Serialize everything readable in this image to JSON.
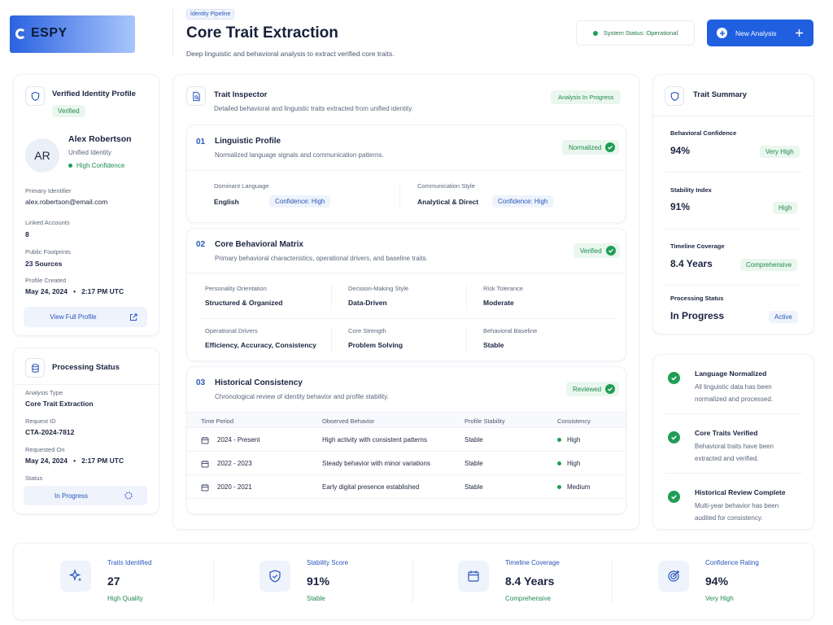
{
  "brand": {
    "name": "ESPY",
    "gradient_from": "#2a62e0",
    "gradient_to": "#a9c6fb"
  },
  "header": {
    "breadcrumb": "Identity Pipeline",
    "title": "Core Trait Extraction",
    "subtitle": "Deep linguistic and behavioral analysis to extract verified core traits.",
    "system_status": "System Status: Operational",
    "new_analysis": "New Analysis"
  },
  "profile": {
    "title": "Verified Identity Profile",
    "verified_badge": "Verified",
    "initials": "AR",
    "name": "Alex Robertson",
    "role": "Unified Identity",
    "confidence": "High Confidence",
    "fields": [
      {
        "label": "Primary Identifier",
        "value": "alex.robertson@email.com"
      },
      {
        "label": "Linked Accounts",
        "value": "8"
      },
      {
        "label": "Public Footprints",
        "value": "23 Sources"
      },
      {
        "label": "Profile Created",
        "value": "May 24, 2024   •   2:17 PM UTC"
      }
    ],
    "view_button": "View Full Profile"
  },
  "processing": {
    "title": "Processing Status",
    "fields": [
      {
        "label": "Analysis Type",
        "value": "Core Trait Extraction"
      },
      {
        "label": "Request ID",
        "value": "CTA-2024-7812"
      },
      {
        "label": "Requested On",
        "value": "May 24, 2024   •   2:17 PM UTC"
      }
    ],
    "status_label": "Status",
    "status_value": "In Progress"
  },
  "inspector": {
    "title": "Trait Inspector",
    "subtitle": "Detailed behavioral and linguistic traits extracted from unified identity.",
    "badge": "Analysis In Progress",
    "linguistic": {
      "num": "01",
      "title": "Linguistic Profile",
      "subtitle": "Normalized language signals and communication patterns.",
      "badge": "Normalized",
      "language_label": "Dominant Language",
      "language_value": "English",
      "language_conf": "Confidence: High",
      "style_label": "Communication Style",
      "style_value": "Analytical & Direct",
      "style_conf": "Confidence: High"
    },
    "behavioral": {
      "num": "02",
      "title": "Core Behavioral Matrix",
      "subtitle": "Primary behavioral characteristics, operational drivers, and baseline traits.",
      "badge": "Verified",
      "cells": [
        {
          "label": "Personality Orientation",
          "value": "Structured & Organized"
        },
        {
          "label": "Decision-Making Style",
          "value": "Data-Driven"
        },
        {
          "label": "Risk Tolerance",
          "value": "Moderate"
        },
        {
          "label": "Operational Drivers",
          "value": "Efficiency, Accuracy, Consistency"
        },
        {
          "label": "Core Strength",
          "value": "Problem Solving"
        },
        {
          "label": "Behavioral Baseline",
          "value": "Stable"
        }
      ]
    },
    "historical": {
      "num": "03",
      "title": "Historical Consistency",
      "subtitle": "Chronological review of identity behavior and profile stability.",
      "badge": "Reviewed",
      "columns": [
        "Time Period",
        "Observed Behavior",
        "Profile Stability",
        "Consistency"
      ],
      "rows": [
        {
          "period": "2024 - Present",
          "behavior": "High activity with consistent patterns",
          "stability": "Stable",
          "consistency": "High"
        },
        {
          "period": "2022 - 2023",
          "behavior": "Steady behavior with minor variations",
          "stability": "Stable",
          "consistency": "High"
        },
        {
          "period": "2020 - 2021",
          "behavior": "Early digital presence established",
          "stability": "Stable",
          "consistency": "Medium"
        }
      ]
    }
  },
  "summary": {
    "title": "Trait Summary",
    "items": [
      {
        "label": "Behavioral Confidence",
        "value": "94%",
        "badge": "Very High"
      },
      {
        "label": "Stability Index",
        "value": "91%",
        "badge": "High"
      },
      {
        "label": "Timeline Coverage",
        "value": "8.4 Years",
        "badge": "Comprehensive"
      },
      {
        "label": "Processing Status",
        "value": "In Progress",
        "badge": "Active"
      }
    ]
  },
  "checklist": [
    {
      "title": "Language Normalized",
      "line1": "All linguistic data has been",
      "line2": "normalized and processed."
    },
    {
      "title": "Core Traits Verified",
      "line1": "Behavioral traits have been",
      "line2": "extracted and verified."
    },
    {
      "title": "Historical Review Complete",
      "line1": "Multi-year behavior has been",
      "line2": "audited for consistency."
    }
  ],
  "stats": [
    {
      "label": "Traits Identified",
      "value": "27",
      "note": "High Quality",
      "icon": "sparkles-icon"
    },
    {
      "label": "Stability Score",
      "value": "91%",
      "note": "Stable",
      "icon": "shield-check-icon"
    },
    {
      "label": "Timeline Coverage",
      "value": "8.4 Years",
      "note": "Comprehensive",
      "icon": "calendar-icon"
    },
    {
      "label": "Confidence Rating",
      "value": "94%",
      "note": "Very High",
      "icon": "target-icon"
    }
  ]
}
